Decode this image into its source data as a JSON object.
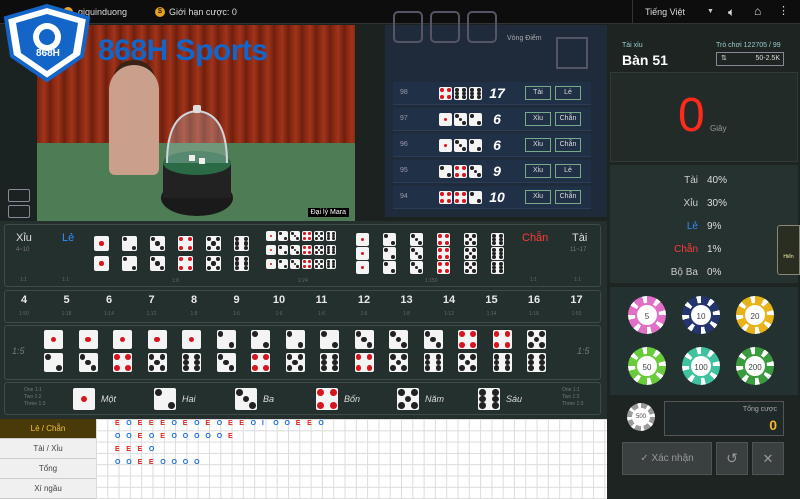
{
  "topbar": {
    "username": "giguinduong",
    "limit_label": "Giới hạn cược: 0",
    "language": "Tiếng Việt",
    "coin_symbol": "$"
  },
  "brand": {
    "logo_text": "868H Sports",
    "shield_text": "868H"
  },
  "video": {
    "label": "Đại lý Mara"
  },
  "history": {
    "title": "Vòng Điểm",
    "rows": [
      {
        "no": "98",
        "dice": [
          4,
          6,
          6
        ],
        "sum": "17",
        "a": "Tài",
        "b": "Lẻ"
      },
      {
        "no": "97",
        "dice": [
          1,
          3,
          2
        ],
        "sum": "6",
        "a": "Xỉu",
        "b": "Chẵn"
      },
      {
        "no": "96",
        "dice": [
          1,
          3,
          2
        ],
        "sum": "6",
        "a": "Xỉu",
        "b": "Chẵn"
      },
      {
        "no": "95",
        "dice": [
          2,
          4,
          3
        ],
        "sum": "9",
        "a": "Xỉu",
        "b": "Lẻ"
      },
      {
        "no": "94",
        "dice": [
          4,
          4,
          2
        ],
        "sum": "10",
        "a": "Xỉu",
        "b": "Chẵn"
      }
    ]
  },
  "table_info": {
    "game_label": "Tài xỉu",
    "table_name": "Bàn 51",
    "round_label": "Trò chơi 122705 / 99",
    "range": "50-2.5K",
    "timer": "0",
    "timer_unit": "Giây"
  },
  "stats": [
    {
      "label": "Tài",
      "value": "40%",
      "color": "#cccccc"
    },
    {
      "label": "Xỉu",
      "value": "30%",
      "color": "#cccccc"
    },
    {
      "label": "Lẻ",
      "value": "9%",
      "color": "#2f8cff"
    },
    {
      "label": "Chẵn",
      "value": "1%",
      "color": "#ff3a3a"
    },
    {
      "label": "Bộ Ba",
      "value": "0%",
      "color": "#cccccc"
    }
  ],
  "side_tab": "Hiển",
  "chips": [
    {
      "value": "5",
      "color": "#e06fc8"
    },
    {
      "value": "10",
      "color": "#24346e"
    },
    {
      "value": "20",
      "color": "#e8b21a"
    },
    {
      "value": "50",
      "color": "#6acb3c"
    },
    {
      "value": "100",
      "color": "#3ec2a0"
    },
    {
      "value": "200",
      "color": "#3b9b3f"
    },
    {
      "value": "500",
      "color": "#cccccc"
    }
  ],
  "total": {
    "label": "Tổng cược",
    "value": "0"
  },
  "actions": {
    "confirm": "Xác nhận",
    "undo": "↺",
    "clear": "✕"
  },
  "board": {
    "xiu": "Xỉu",
    "xiu_range": "4~10",
    "xiu_odds": "1:1",
    "le": "Lẻ",
    "le_odds": "1:1",
    "chan": "Chẵn",
    "chan_odds": "1:1",
    "tai": "Tài",
    "tai_range": "11~17",
    "tai_odds": "1:1",
    "pair_odds": "1:8",
    "triple_any_odds": "1:24",
    "triple_odds": "1:150",
    "sums": [
      {
        "n": "4",
        "o": "1:50"
      },
      {
        "n": "5",
        "o": "1:18"
      },
      {
        "n": "6",
        "o": "1:14"
      },
      {
        "n": "7",
        "o": "1:12"
      },
      {
        "n": "8",
        "o": "1:8"
      },
      {
        "n": "9",
        "o": "1:6"
      },
      {
        "n": "10",
        "o": "1:6"
      },
      {
        "n": "11",
        "o": "1:6"
      },
      {
        "n": "12",
        "o": "1:6"
      },
      {
        "n": "13",
        "o": "1:8"
      },
      {
        "n": "14",
        "o": "1:12"
      },
      {
        "n": "15",
        "o": "1:14"
      },
      {
        "n": "16",
        "o": "1:18"
      },
      {
        "n": "17",
        "o": "1:50"
      }
    ],
    "combo_odds": "1:5",
    "singles": [
      {
        "face": 1,
        "label": "Một"
      },
      {
        "face": 2,
        "label": "Hai"
      },
      {
        "face": 3,
        "label": "Ba"
      },
      {
        "face": 4,
        "label": "Bốn"
      },
      {
        "face": 5,
        "label": "Năm"
      },
      {
        "face": 6,
        "label": "Sáu"
      }
    ],
    "single_odds": [
      "One 1:1",
      "Two 1:2",
      "Three 1:3"
    ]
  },
  "roadmap": {
    "rows": [
      "Lẻ / Chẵn",
      "Tài / Xỉu",
      "Tổng",
      "Xí ngầu"
    ],
    "r0": [
      "E",
      "O",
      "E",
      "E",
      "E",
      "O",
      "E",
      "O",
      "E",
      "O",
      "E",
      "E",
      "O",
      "I",
      "O",
      "O",
      "E",
      "E",
      "O"
    ],
    "r1": [
      "O",
      "O",
      "E",
      "O",
      "E",
      "O",
      "O",
      "O",
      "O",
      "O",
      "E"
    ],
    "r2": [
      "E",
      "E",
      "E",
      "O"
    ],
    "r3": [
      "O",
      "O",
      "E",
      "E",
      "O",
      "O",
      "O",
      "O"
    ]
  }
}
